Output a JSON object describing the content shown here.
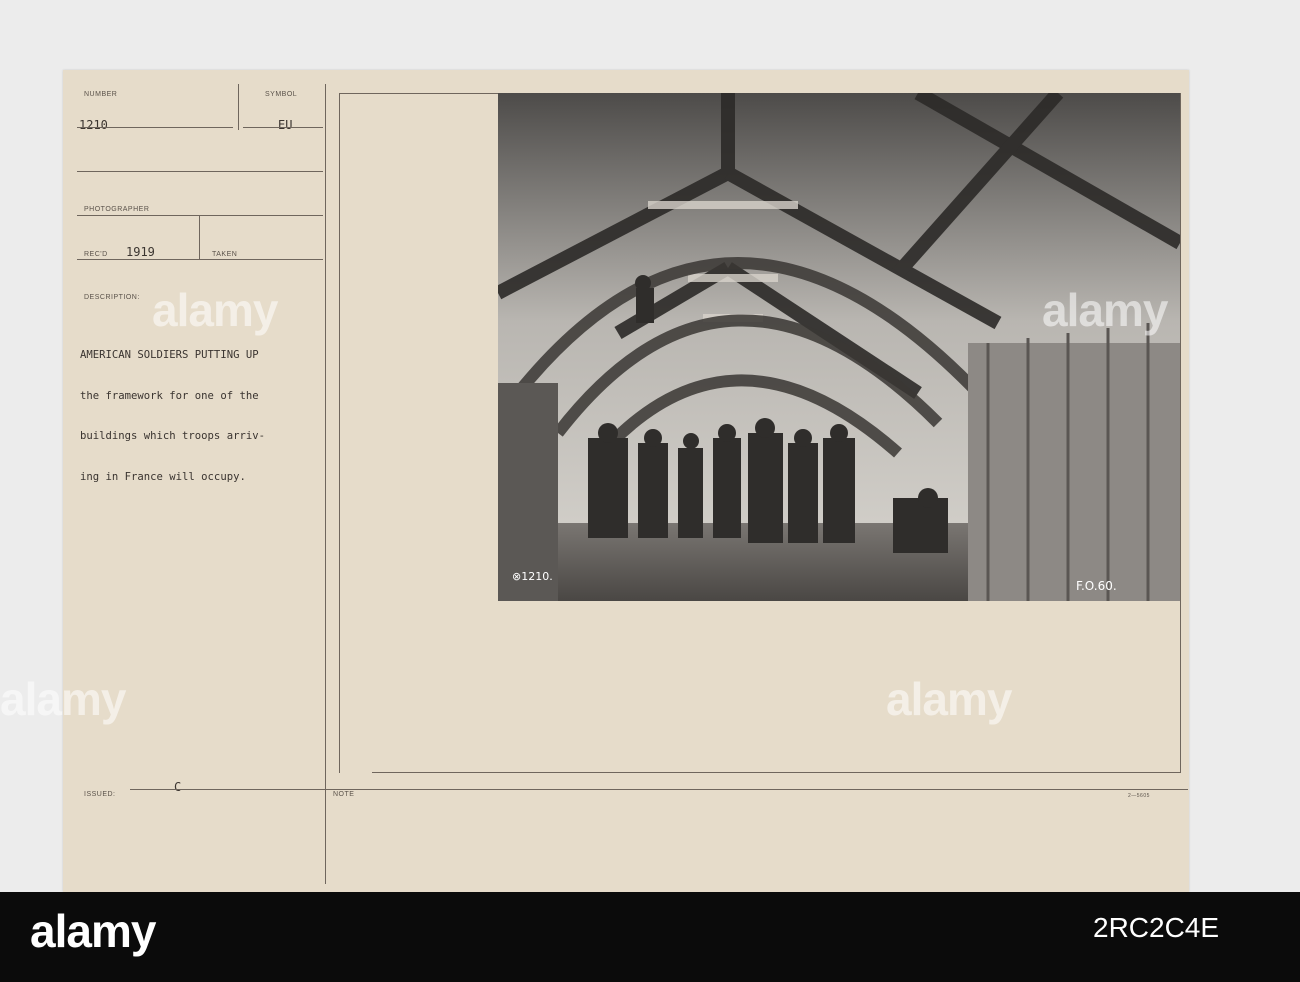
{
  "card": {
    "number_label": "NUMBER",
    "number_value": "1210",
    "symbol_label": "SYMBOL",
    "symbol_value": "EU",
    "photographer_label": "PHOTOGRAPHER",
    "recd_label": "REC'D",
    "recd_value": "1919",
    "taken_label": "TAKEN",
    "description_label": "DESCRIPTION:",
    "description_lines": [
      "AMERICAN SOLDIERS PUTTING UP",
      "the framework for one of the",
      "buildings which troops arriv-",
      "ing in France will occupy."
    ],
    "issued_label": "ISSUED:",
    "issued_value": "C",
    "note_label": "NOTE",
    "form_number": "2—5605"
  },
  "photo": {
    "negative_number": "⊗1210.",
    "fo_number": "F.O.60."
  },
  "watermark": {
    "text": "alamy"
  },
  "footer": {
    "logo": "alamy",
    "image_id": "2RC2C4E"
  }
}
